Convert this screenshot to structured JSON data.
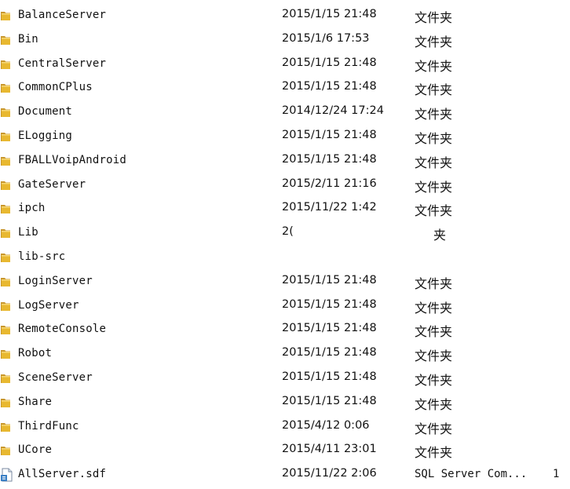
{
  "files": [
    {
      "name": "BalanceServer",
      "date": "2015/1/15 21:48",
      "type": "文件夹",
      "icon": "folder-icon"
    },
    {
      "name": "Bin",
      "date": "2015/1/6 17:53",
      "type": "文件夹",
      "icon": "folder-icon"
    },
    {
      "name": "CentralServer",
      "date": "2015/1/15 21:48",
      "type": "文件夹",
      "icon": "folder-icon"
    },
    {
      "name": "CommonCPlus",
      "date": "2015/1/15 21:48",
      "type": "文件夹",
      "icon": "folder-icon"
    },
    {
      "name": "Document",
      "date": "2014/12/24 17:24",
      "type": "文件夹",
      "icon": "folder-icon"
    },
    {
      "name": "ELogging",
      "date": "2015/1/15 21:48",
      "type": "文件夹",
      "icon": "folder-icon"
    },
    {
      "name": "FBALLVoipAndroid",
      "date": "2015/1/15 21:48",
      "type": "文件夹",
      "icon": "folder-icon"
    },
    {
      "name": "GateServer",
      "date": "2015/2/11 21:16",
      "type": "文件夹",
      "icon": "folder-icon"
    },
    {
      "name": "ipch",
      "date": "2015/11/22 1:42",
      "type": "文件夹",
      "icon": "folder-icon"
    },
    {
      "name": "Lib",
      "date": "2(",
      "type": "夹",
      "icon": "folder-icon"
    },
    {
      "name": "lib-src",
      "date": "",
      "type": "",
      "icon": "folder-icon"
    },
    {
      "name": "LoginServer",
      "date": "2015/1/15 21:48",
      "type": "文件夹",
      "icon": "folder-icon"
    },
    {
      "name": "LogServer",
      "date": "2015/1/15 21:48",
      "type": "文件夹",
      "icon": "folder-icon"
    },
    {
      "name": "RemoteConsole",
      "date": "2015/1/15 21:48",
      "type": "文件夹",
      "icon": "folder-icon"
    },
    {
      "name": "Robot",
      "date": "2015/1/15 21:48",
      "type": "文件夹",
      "icon": "folder-icon"
    },
    {
      "name": "SceneServer",
      "date": "2015/1/15 21:48",
      "type": "文件夹",
      "icon": "folder-icon"
    },
    {
      "name": "Share",
      "date": "2015/1/15 21:48",
      "type": "文件夹",
      "icon": "folder-icon"
    },
    {
      "name": "ThirdFunc",
      "date": "2015/4/12 0:06",
      "type": "文件夹",
      "icon": "folder-icon"
    },
    {
      "name": "UCore",
      "date": "2015/4/11 23:01",
      "type": "文件夹",
      "icon": "folder-icon"
    },
    {
      "name": "AllServer.sdf",
      "date": "2015/11/22 2:06",
      "type": "SQL Server Com...",
      "size": "1",
      "icon": "sdf-file-icon"
    }
  ],
  "colors": {
    "folder": "#e8b830",
    "folder_dark": "#c8962a",
    "background": "#ffffff"
  }
}
